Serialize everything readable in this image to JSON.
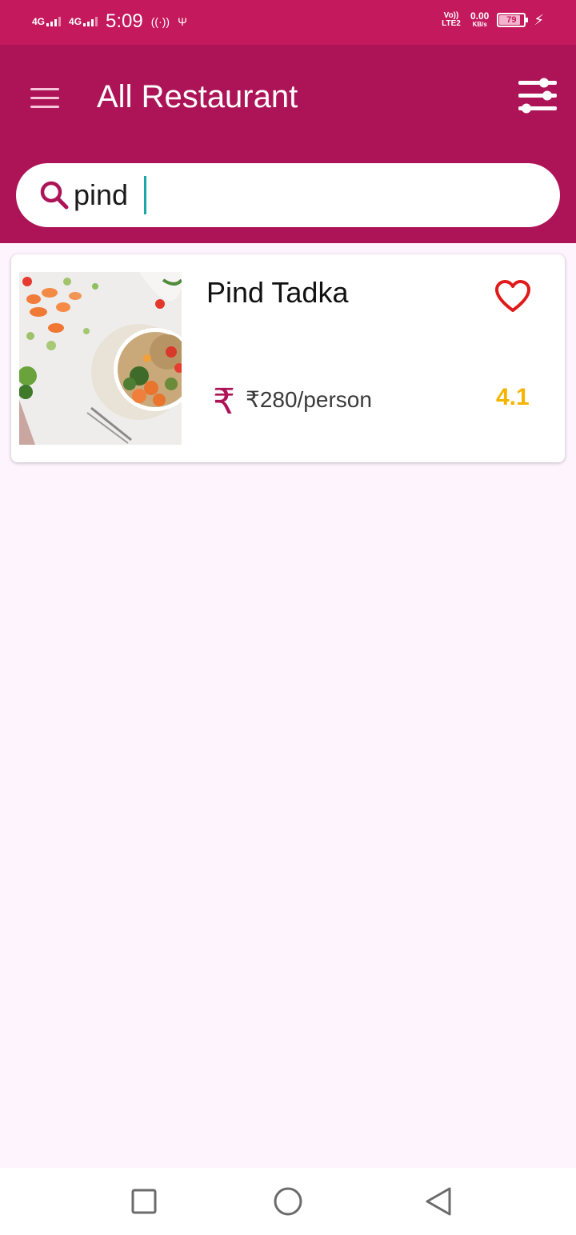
{
  "status_bar": {
    "net1": "4G",
    "net2": "4G",
    "time": "5:09",
    "volte": "Vo)) LTE2",
    "speed_value": "0.00",
    "speed_unit": "KB/s",
    "battery": "79"
  },
  "app_bar": {
    "title": "All Restaurant",
    "menu_icon": "hamburger-menu-icon",
    "filter_icon": "sliders-filter-icon",
    "color": "#ad1457"
  },
  "search": {
    "value": "pind",
    "placeholder": "",
    "icon": "search-icon"
  },
  "results": [
    {
      "name": "Pind Tadka",
      "price": "₹280/person",
      "rupee_symbol": "₹",
      "rating": "4.1",
      "favorite_icon": "heart-outline-icon",
      "image": "food-bowl-photo"
    }
  ],
  "nav_bar": {
    "recent_icon": "square-recents-icon",
    "home_icon": "circle-home-icon",
    "back_icon": "triangle-back-icon"
  },
  "colors": {
    "status_bar": "#c4195d",
    "app_bar": "#ad1457",
    "background": "#fdf4fd",
    "rating": "#f4b400",
    "heart": "#e01a1a"
  }
}
